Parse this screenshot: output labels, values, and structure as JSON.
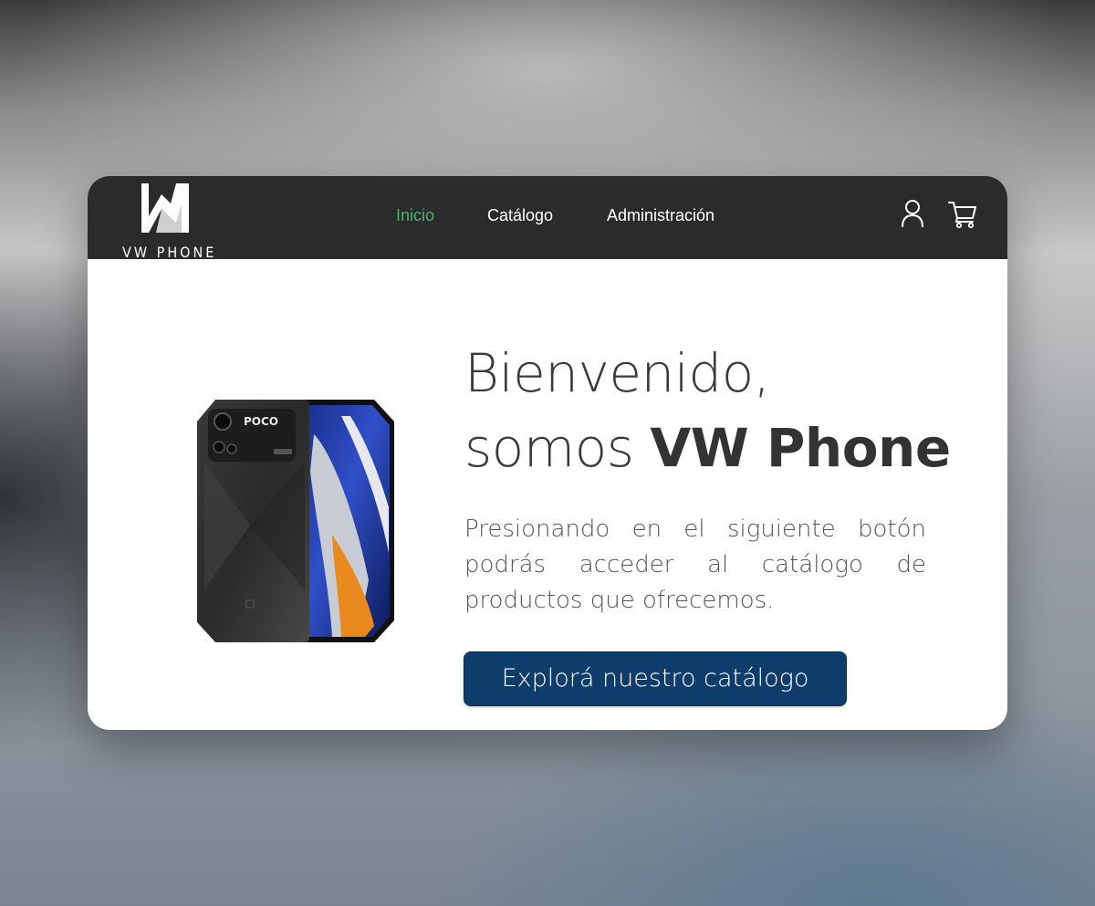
{
  "brand": {
    "name": "VW PHONE",
    "logo_icon": "vw-logo-icon"
  },
  "nav": {
    "items": [
      {
        "label": "Inicio",
        "active": true
      },
      {
        "label": "Catálogo",
        "active": false
      },
      {
        "label": "Administración",
        "active": false
      }
    ],
    "active_color": "#4caf74",
    "icons": [
      "user-icon",
      "cart-icon"
    ]
  },
  "hero": {
    "title_line1": "Bienvenido,",
    "title_prefix": "somos ",
    "title_brand": "VW Phone",
    "description": "Presionando en el siguiente botón podrás acceder al catálogo de productos que ofrecemos.",
    "cta_label": "Explorá nuestro catálogo",
    "cta_color": "#0f3d6b",
    "product_image": {
      "phone_brand_text": "POCO"
    }
  },
  "colors": {
    "navbar_bg": "#2b2b2b",
    "card_bg": "#ffffff"
  }
}
